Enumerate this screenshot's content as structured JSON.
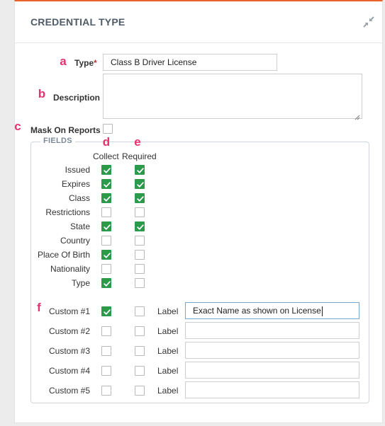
{
  "panel": {
    "title": "CREDENTIAL TYPE",
    "accent_color": "#e8632b",
    "collapse_icon": "compress-arrows-icon"
  },
  "markers": [
    "a",
    "b",
    "c",
    "d",
    "e",
    "f"
  ],
  "form": {
    "type_label": "Type",
    "required_mark": "*",
    "type_value": "Class B Driver License",
    "description_label": "Description",
    "description_value": "",
    "mask_label": "Mask On Reports",
    "mask_checked": false
  },
  "fields": {
    "legend": "FIELDS",
    "collect_header": "Collect",
    "required_header": "Required",
    "rows": [
      {
        "label": "Issued",
        "collect": true,
        "required": true
      },
      {
        "label": "Expires",
        "collect": true,
        "required": true
      },
      {
        "label": "Class",
        "collect": true,
        "required": true
      },
      {
        "label": "Restrictions",
        "collect": false,
        "required": false
      },
      {
        "label": "State",
        "collect": true,
        "required": true
      },
      {
        "label": "Country",
        "collect": false,
        "required": false
      },
      {
        "label": "Place Of Birth",
        "collect": true,
        "required": false
      },
      {
        "label": "Nationality",
        "collect": false,
        "required": false
      },
      {
        "label": "Type",
        "collect": true,
        "required": false
      }
    ],
    "label_word": "Label",
    "custom": [
      {
        "label": "Custom #1",
        "collect": true,
        "required": false,
        "value": "Exact Name as shown on License"
      },
      {
        "label": "Custom #2",
        "collect": false,
        "required": false,
        "value": ""
      },
      {
        "label": "Custom #3",
        "collect": false,
        "required": false,
        "value": ""
      },
      {
        "label": "Custom #4",
        "collect": false,
        "required": false,
        "value": ""
      },
      {
        "label": "Custom #5",
        "collect": false,
        "required": false,
        "value": ""
      }
    ]
  },
  "colors": {
    "check_green": "#2c9a4b",
    "marker_pink": "#e5316e"
  }
}
